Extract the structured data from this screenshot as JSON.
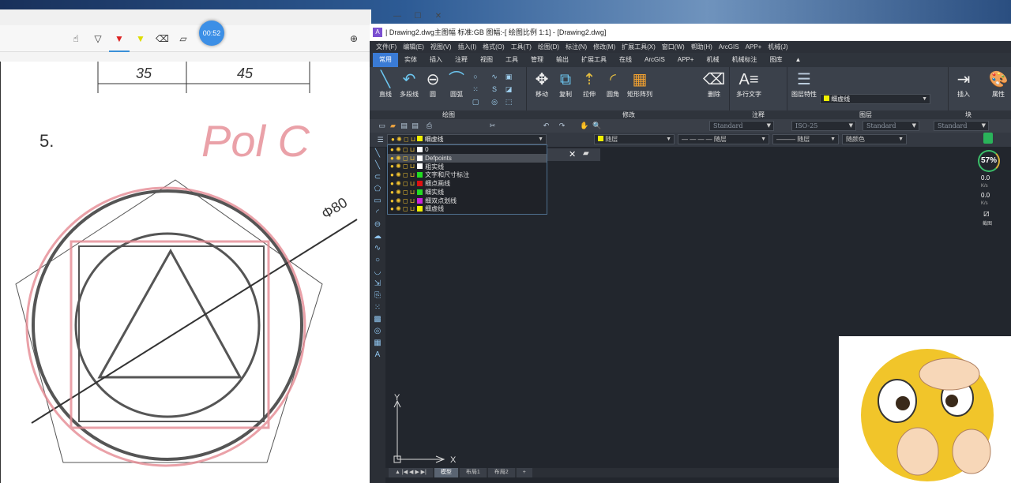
{
  "left_window": {
    "timer": "00:52",
    "tools": [
      "hand-draw-icon",
      "pen-icon",
      "red-marker-icon",
      "yellow-highlighter-icon",
      "eraser-icon",
      "ruler-icon"
    ],
    "zoom_icon": "zoom-in-icon"
  },
  "sketch": {
    "dim1": "35",
    "dim2": "45",
    "problem_no": "5.",
    "diameter": "Φ80",
    "handwriting": "Pol C"
  },
  "cad": {
    "title": "| Drawing2.dwg主图幅  标准:GB 图幅:-[ 绘图比例 1:1] - [Drawing2.dwg]",
    "menu": [
      "文件(F)",
      "编辑(E)",
      "视图(V)",
      "插入(I)",
      "格式(O)",
      "工具(T)",
      "绘图(D)",
      "标注(N)",
      "修改(M)",
      "扩展工具(X)",
      "窗口(W)",
      "帮助(H)",
      "ArcGIS",
      "APP+",
      "机械(J)"
    ],
    "tabs": [
      "常用",
      "实体",
      "插入",
      "注释",
      "视图",
      "工具",
      "管理",
      "输出",
      "扩展工具",
      "在线",
      "ArcGIS",
      "APP+",
      "机械",
      "机械标注",
      "图库"
    ],
    "ribbon": {
      "draw": [
        "直线",
        "多段线",
        "圆",
        "圆弧"
      ],
      "modify": [
        "移动",
        "复制",
        "拉伸",
        "圆角",
        "矩形阵列",
        "删除"
      ],
      "annotate": [
        "多行文字"
      ],
      "layer": [
        "图层特性"
      ],
      "block": [
        "插入"
      ],
      "props": [
        "属性"
      ],
      "current_layer": "细虚线"
    },
    "panels": [
      "绘图",
      "修改",
      "注释",
      "图层",
      "块"
    ],
    "styles": {
      "text": "Standard",
      "dim": "ISO-25",
      "table": "Standard",
      "mleader": "Standard"
    },
    "layer_combo": "细虚线",
    "props": {
      "color": "随层",
      "linetype": "— — — — 随层",
      "lineweight": "——— 随层",
      "plotstyle": "随颜色"
    },
    "layers": [
      {
        "name": "0",
        "color": "#ffffff"
      },
      {
        "name": "Defpoints",
        "color": "#ffffff"
      },
      {
        "name": "粗实线",
        "color": "#ffffff"
      },
      {
        "name": "文字和尺寸标注",
        "color": "#22dd22"
      },
      {
        "name": "细点画线",
        "color": "#dd1111"
      },
      {
        "name": "细实线",
        "color": "#22dd22"
      },
      {
        "name": "细双点划线",
        "color": "#cc22dd"
      },
      {
        "name": "细虚线",
        "color": "#f0f000"
      }
    ],
    "layout_tabs": [
      "模型",
      "布局1",
      "布局2",
      "+"
    ],
    "axes": {
      "x": "X",
      "y": "Y"
    },
    "monitor": {
      "cpu": "57%",
      "up": "0.0",
      "up_unit": "K/s",
      "down": "0.0",
      "down_unit": "K/s",
      "shot": "截图"
    }
  }
}
